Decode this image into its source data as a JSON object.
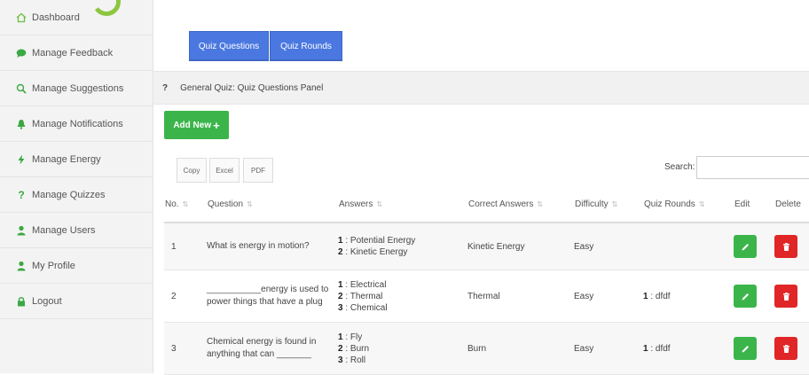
{
  "sidebar": {
    "items": [
      {
        "label": "Dashboard",
        "icon": "home-icon"
      },
      {
        "label": "Manage Feedback",
        "icon": "comment-icon"
      },
      {
        "label": "Manage Suggestions",
        "icon": "search-chat-icon"
      },
      {
        "label": "Manage Notifications",
        "icon": "bell-icon"
      },
      {
        "label": "Manage Energy",
        "icon": "bolt-icon"
      },
      {
        "label": "Manage Quizzes",
        "icon": "question-icon"
      },
      {
        "label": "Manage Users",
        "icon": "user-icon"
      },
      {
        "label": "My Profile",
        "icon": "user-icon"
      },
      {
        "label": "Logout",
        "icon": "lock-icon"
      }
    ]
  },
  "top_buttons": {
    "quiz_questions": "Quiz Questions",
    "quiz_rounds": "Quiz Rounds"
  },
  "breadcrumb": {
    "marker": "?",
    "text": "General Quiz: Quiz Questions Panel"
  },
  "toolbar": {
    "add_new": "Add New",
    "add_plus": "+",
    "copy": "Copy",
    "excel": "Excel",
    "pdf": "PDF",
    "search_label": "Search:",
    "search_value": ""
  },
  "table": {
    "headers": [
      "No.",
      "Question",
      "Answers",
      "Correct Answers",
      "Difficulty",
      "Quiz Rounds",
      "Edit",
      "Delete"
    ],
    "rows": [
      {
        "no": "1",
        "question": "What is energy in motion?",
        "answers": [
          {
            "num": "1",
            "text": ": Potential Energy"
          },
          {
            "num": "2",
            "text": ": Kinetic Energy"
          }
        ],
        "correct": "Kinetic Energy",
        "difficulty": "Easy",
        "rounds_num": "",
        "rounds_text": ""
      },
      {
        "no": "2",
        "question": "___________energy is used to power things that have a plug",
        "answers": [
          {
            "num": "1",
            "text": ": Electrical"
          },
          {
            "num": "2",
            "text": ": Thermal"
          },
          {
            "num": "3",
            "text": ": Chemical"
          }
        ],
        "correct": "Thermal",
        "difficulty": "Easy",
        "rounds_num": "1",
        "rounds_text": ": dfdf"
      },
      {
        "no": "3",
        "question": "Chemical energy is found in anything that can _______",
        "answers": [
          {
            "num": "1",
            "text": ": Fly"
          },
          {
            "num": "2",
            "text": ": Burn"
          },
          {
            "num": "3",
            "text": ": Roll"
          }
        ],
        "correct": "Burn",
        "difficulty": "Easy",
        "rounds_num": "1",
        "rounds_text": ": dfdf"
      }
    ]
  },
  "colors": {
    "primary_blue": "#4a78e0",
    "success_green": "#3bb54a",
    "danger_red": "#e02626",
    "logo_green": "#8dc63f"
  }
}
